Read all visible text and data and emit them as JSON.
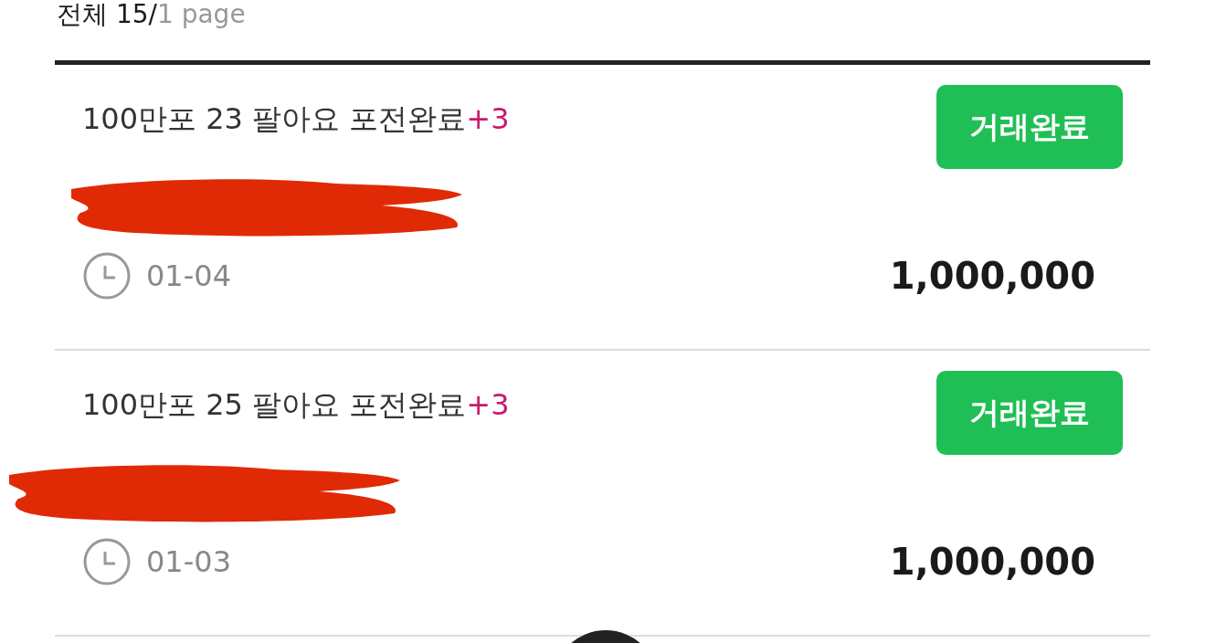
{
  "summary": {
    "total": "전체 15/",
    "pages": "1 page"
  },
  "posts": [
    {
      "title": "100만포 23 팔아요 포전완료",
      "comment_count": "+3",
      "status": "거래완료",
      "date": "01-04",
      "price": "1,000,000"
    },
    {
      "title": "100만포 25 팔아요 포전완료",
      "comment_count": "+3",
      "status": "거래완료",
      "date": "01-03",
      "price": "1,000,000"
    }
  ]
}
